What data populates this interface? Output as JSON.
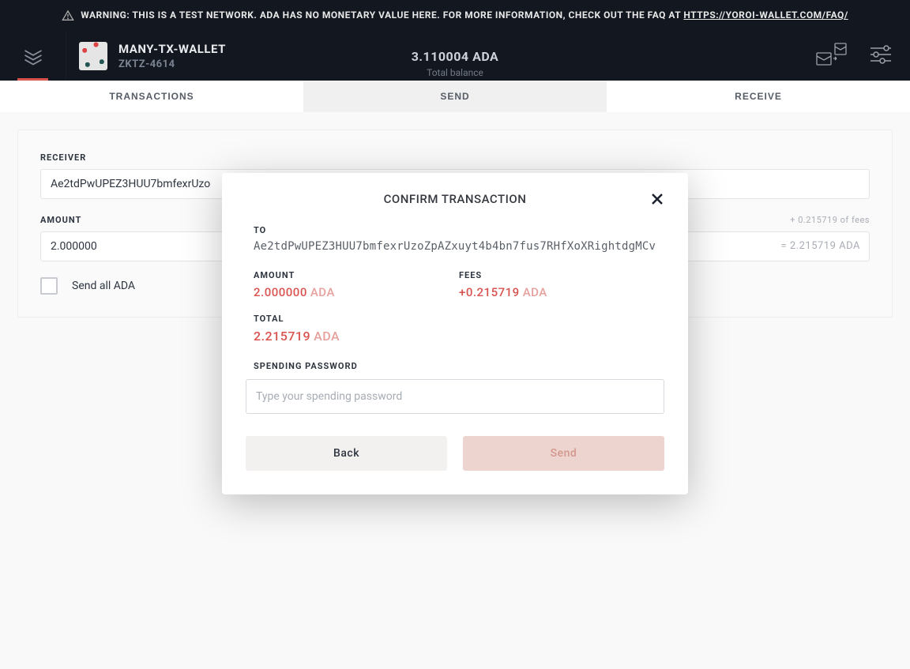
{
  "warning": {
    "text": "WARNING: THIS IS A TEST NETWORK. ADA HAS NO MONETARY VALUE HERE. FOR MORE INFORMATION, CHECK OUT THE FAQ AT ",
    "link": "HTTPS://YOROI-WALLET.COM/FAQ/"
  },
  "wallet": {
    "name": "MANY-TX-WALLET",
    "plate": "ZKTZ-4614",
    "balance": "3.110004 ADA",
    "balance_label": "Total balance"
  },
  "tabs": {
    "transactions": "TRANSACTIONS",
    "send": "SEND",
    "receive": "RECEIVE"
  },
  "form": {
    "receiver_label": "RECEIVER",
    "receiver_value": "Ae2tdPwUPEZ3HUU7bmfexrUzo",
    "amount_label": "AMOUNT",
    "amount_value": "2.000000",
    "fees_hint": "+ 0.215719 of fees",
    "eq_hint": "= 2.215719 ADA",
    "send_all_label": "Send all ADA"
  },
  "modal": {
    "title": "CONFIRM TRANSACTION",
    "to_label": "TO",
    "to_address": "Ae2tdPwUPEZ3HUU7bmfexrUzoZpAZxuyt4b4bn7fus7RHfXoXRightdgMCv",
    "amount_label": "AMOUNT",
    "amount_value": "2.000000",
    "amount_currency": "ADA",
    "fees_label": "FEES",
    "fees_value": "+0.215719",
    "fees_currency": "ADA",
    "total_label": "TOTAL",
    "total_value": "2.215719",
    "total_currency": "ADA",
    "password_label": "SPENDING PASSWORD",
    "password_placeholder": "Type your spending password",
    "back_button": "Back",
    "send_button": "Send"
  }
}
